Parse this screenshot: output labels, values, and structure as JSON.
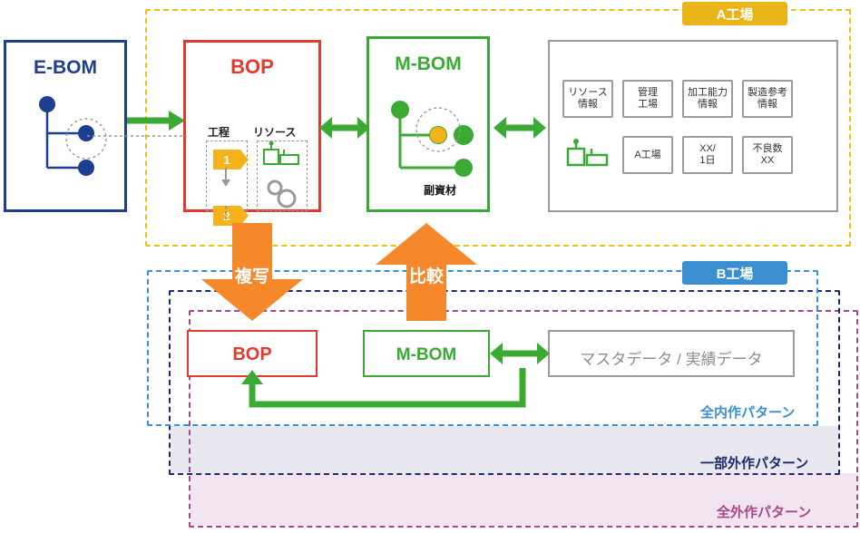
{
  "regions": {
    "factory_a": "A工場",
    "factory_b": "B工場",
    "pattern_all_inhouse": "全内作パターン",
    "pattern_partial_outsource": "一部外作パターン",
    "pattern_all_outsource": "全外作パターン"
  },
  "top": {
    "ebom": {
      "title": "E-BOM"
    },
    "bop": {
      "title": "BOP",
      "col_process": "工程",
      "col_resource": "リソース",
      "step1": "1",
      "step2": "2"
    },
    "mbom": {
      "title": "M-BOM",
      "sub_material": "副資材"
    },
    "info": {
      "chips": [
        "リソース\n情報",
        "管理\n工場",
        "加工能力\n情報",
        "製造参考\n情報",
        "A工場",
        "XX/\n1日",
        "不良数\nXX"
      ],
      "chip_row1": [
        "リソース情報",
        "管理工場",
        "加工能力情報",
        "製造参考情報"
      ],
      "chip_row2": [
        "A工場",
        "XX/1日",
        "不良数XX"
      ],
      "chip_row1_lines": [
        [
          "リソース",
          "情報"
        ],
        [
          "管理",
          "工場"
        ],
        [
          "加工能力",
          "情報"
        ],
        [
          "製造参考",
          "情報"
        ]
      ],
      "chip_row2_lines": [
        [
          "A工場"
        ],
        [
          "XX/",
          "1日"
        ],
        [
          "不良数",
          "XX"
        ]
      ]
    }
  },
  "arrows": {
    "copy": "複写",
    "compare": "比較"
  },
  "bottom": {
    "bop": {
      "title": "BOP"
    },
    "mbom": {
      "title": "M-BOM"
    },
    "master": {
      "title": "マスタデータ / 実績データ"
    }
  },
  "colors": {
    "yellow": "#e8b417",
    "blue": "#3a8fd0",
    "navy": "#1c2c6b",
    "purple": "#a6468c",
    "red": "#e23b2e",
    "green": "#3aaa35",
    "orange": "#f5882a",
    "gray": "#9a9a9a",
    "ebom_blue": "#1c3f8f"
  }
}
